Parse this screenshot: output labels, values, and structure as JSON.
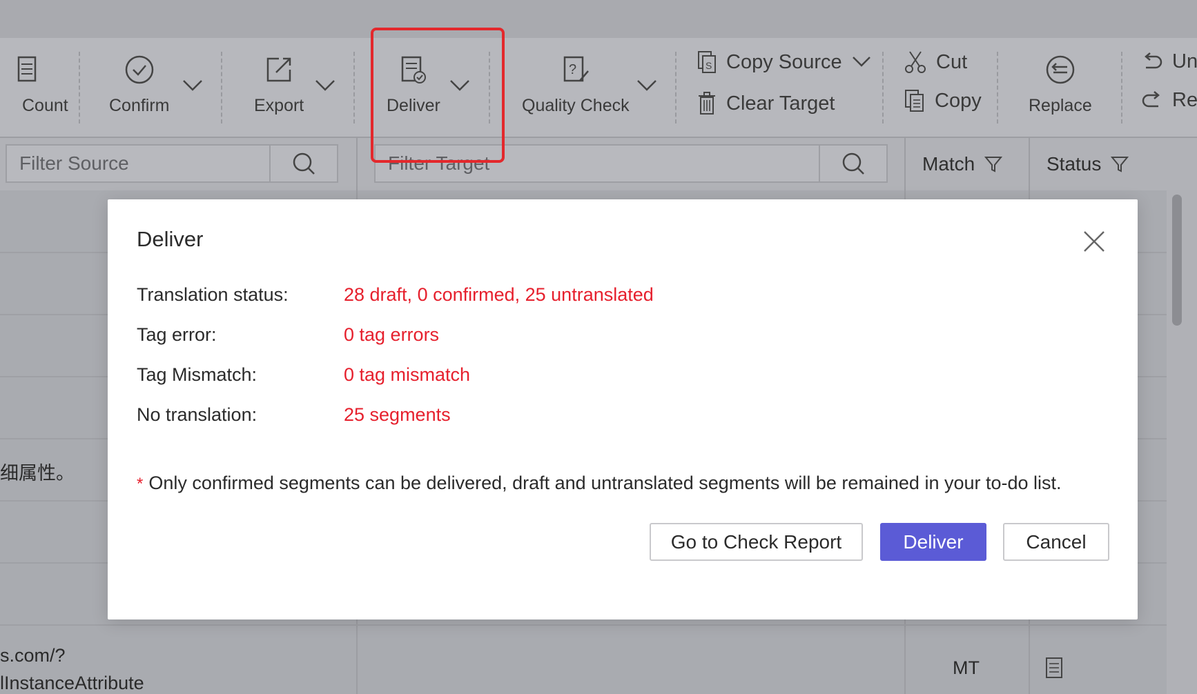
{
  "toolbar": {
    "count_label": "Count",
    "confirm_label": "Confirm",
    "export_label": "Export",
    "deliver_label": "Deliver",
    "quality_check_label": "Quality Check",
    "copy_source_label": "Copy Source",
    "clear_target_label": "Clear Target",
    "cut_label": "Cut",
    "copy_label": "Copy",
    "replace_label": "Replace",
    "undo_label": "Un",
    "redo_label": "Re"
  },
  "filters": {
    "source_placeholder": "Filter Source",
    "target_placeholder": "Filter Target"
  },
  "columns": {
    "match": "Match",
    "status": "Status"
  },
  "rows": {
    "chinese_fragment": "细属性。",
    "url_line1": "s.com/?",
    "url_line2": "lInstanceAttribute",
    "match_value": "MT"
  },
  "dialog": {
    "title": "Deliver",
    "stats": [
      {
        "label": "Translation status:",
        "value": "28 draft, 0 confirmed, 25 untranslated"
      },
      {
        "label": "Tag error:",
        "value": "0 tag errors"
      },
      {
        "label": "Tag Mismatch:",
        "value": "0 tag mismatch"
      },
      {
        "label": "No translation:",
        "value": "25 segments"
      }
    ],
    "note_star": "*",
    "note": "Only confirmed segments can be delivered, draft and untranslated segments will be remained in your to-do list.",
    "check_report_label": "Go to Check Report",
    "deliver_label": "Deliver",
    "cancel_label": "Cancel"
  },
  "colors": {
    "highlight": "#e3282c",
    "primary": "#5b5bd6",
    "error_text": "#e6202d"
  }
}
